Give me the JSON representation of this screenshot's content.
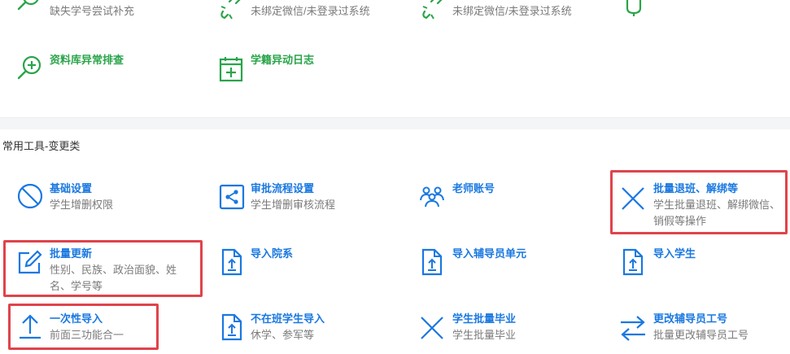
{
  "top_section": {
    "items": [
      {
        "desc": "缺失学号尝试补充",
        "icon": "search-icon"
      },
      {
        "desc": "未绑定微信/未登录过系统",
        "icon": "broken-link-icon"
      },
      {
        "desc": "未绑定微信/未登录过系统",
        "icon": "broken-link-icon"
      },
      {
        "icon": "bell-icon"
      },
      {
        "title": "资料库异常排查",
        "icon": "search-plus-icon"
      },
      {
        "title": "学籍异动日志",
        "icon": "calendar-plus-icon"
      }
    ]
  },
  "section": {
    "title": "常用工具-变更类"
  },
  "tools": [
    {
      "title": "基础设置",
      "desc": "学生增删权限",
      "icon": "ban-icon"
    },
    {
      "title": "审批流程设置",
      "desc": "学生增删审核流程",
      "icon": "share-icon"
    },
    {
      "title": "老师账号",
      "desc": "",
      "icon": "users-icon"
    },
    {
      "title": "批量退班、解绑等",
      "desc": "学生批量退班、解绑微信、销假等操作",
      "icon": "close-icon"
    },
    {
      "title": "批量更新",
      "desc": "性别、民族、政治面貌、姓名、学号等",
      "icon": "edit-icon"
    },
    {
      "title": "导入院系",
      "desc": "",
      "icon": "file-upload-icon"
    },
    {
      "title": "导入辅导员单元",
      "desc": "",
      "icon": "file-upload-icon"
    },
    {
      "title": "导入学生",
      "desc": "",
      "icon": "file-upload-icon"
    },
    {
      "title": "一次性导入",
      "desc": "前面三功能合一",
      "icon": "upload-icon"
    },
    {
      "title": "不在班学生导入",
      "desc": "休学、参军等",
      "icon": "file-upload-icon"
    },
    {
      "title": "学生批量毕业",
      "desc": "学生批量毕业",
      "icon": "close-icon"
    },
    {
      "title": "更改辅导员工号",
      "desc": "批量更改辅导员工号",
      "icon": "swap-icon"
    }
  ],
  "colors": {
    "green": "#2aa44a",
    "blue": "#1a78e0",
    "highlight": "#e0434b"
  }
}
